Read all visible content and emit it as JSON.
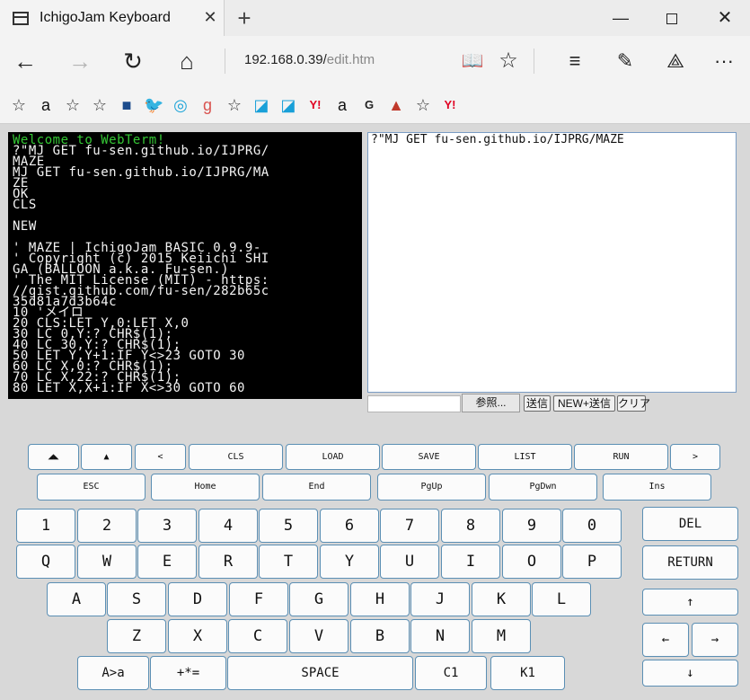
{
  "browser": {
    "tab_title": "IchigoJam Keyboard",
    "tab_close": "✕",
    "new_tab": "+",
    "window_controls": {
      "minimize": "—",
      "close": "✕"
    },
    "address_host": "192.168.0.39/",
    "address_path": "edit.htm",
    "nav": {
      "back": "←",
      "forward": "→",
      "refresh": "↻",
      "home": "⌂",
      "reading_view": "📖",
      "favorite": "☆",
      "hub": "≡",
      "note": "✎",
      "share": "⟁",
      "more": "···"
    },
    "favorites": [
      {
        "icon": "star-icon",
        "glyph": "☆"
      },
      {
        "icon": "amazon-icon",
        "glyph": "a",
        "color": "#111111"
      },
      {
        "icon": "star-icon",
        "glyph": "☆"
      },
      {
        "icon": "star-icon",
        "glyph": "☆"
      },
      {
        "icon": "news-icon",
        "glyph": "■",
        "color": "#1c4c8c"
      },
      {
        "icon": "twitter-icon",
        "glyph": "🐦",
        "color": "#1da1f2"
      },
      {
        "icon": "target-icon",
        "glyph": "◎",
        "color": "#1aa3d8"
      },
      {
        "icon": "g-icon",
        "glyph": "g",
        "color": "#d9534f"
      },
      {
        "icon": "star-icon",
        "glyph": "☆"
      },
      {
        "icon": "app-icon",
        "glyph": "◪",
        "color": "#19a0d8"
      },
      {
        "icon": "app-icon",
        "glyph": "◪",
        "color": "#19a0d8"
      },
      {
        "icon": "yahoo-icon",
        "glyph": "Y!",
        "color": "#e00022"
      },
      {
        "icon": "amazon-icon",
        "glyph": "a",
        "color": "#111111"
      },
      {
        "icon": "g-box-icon",
        "glyph": "G",
        "color": "#222222"
      },
      {
        "icon": "rocket-icon",
        "glyph": "▲",
        "color": "#c0392b"
      },
      {
        "icon": "star-icon",
        "glyph": "☆"
      },
      {
        "icon": "yahoo-icon",
        "glyph": "Y!",
        "color": "#e00022"
      }
    ]
  },
  "terminal": {
    "lines": [
      "Welcome to WebTerm!",
      "?\"MJ GET fu-sen.github.io/IJPRG/",
      "MAZE",
      "MJ GET fu-sen.github.io/IJPRG/MA",
      "ZE",
      "OK",
      "CLS",
      "",
      "NEW",
      "",
      "' MAZE | IchigoJam BASIC 0.9.9-",
      "' Copyright (c) 2015 Keiichi SHI",
      "GA (BALLOON a.k.a. Fu-sen.)",
      "' The MIT License (MIT) - https:",
      "//gist.github.com/fu-sen/282b65c",
      "35d81a7d3b64c",
      "10 'メイロ",
      "20 CLS:LET Y,0:LET X,0",
      "30 LC 0,Y:? CHR$(1);",
      "40 LC 30,Y:? CHR$(1);",
      "50 LET Y,Y+1:IF Y<>23 GOTO 30",
      "60 LC X,0:? CHR$(1);",
      "70 LC X,22:? CHR$(1);",
      "80 LET X,X+1:IF X<>30 GOTO 60"
    ]
  },
  "editor": {
    "value": "?\"MJ GET fu-sen.github.io/IJPRG/MAZE"
  },
  "controls": {
    "browse": "参照...",
    "send": "送信",
    "new_send": "NEW+送信",
    "clear": "クリア"
  },
  "keyboard": {
    "row1": [
      "◢◣",
      "▲",
      "<",
      "CLS",
      "LOAD",
      "SAVE",
      "LIST",
      "RUN",
      ">"
    ],
    "row2": [
      "ESC",
      "Home",
      "End",
      "PgUp",
      "PgDwn",
      "Ins"
    ],
    "row3": [
      "1",
      "2",
      "3",
      "4",
      "5",
      "6",
      "7",
      "8",
      "9",
      "0"
    ],
    "row4": [
      "Q",
      "W",
      "E",
      "R",
      "T",
      "Y",
      "U",
      "I",
      "O",
      "P"
    ],
    "row5": [
      "A",
      "S",
      "D",
      "F",
      "G",
      "H",
      "J",
      "K",
      "L"
    ],
    "row6": [
      "Z",
      "X",
      "C",
      "V",
      "B",
      "N",
      "M"
    ],
    "row7": [
      "A>a",
      "+*=",
      "SPACE",
      "C1",
      "K1"
    ],
    "side": {
      "del": "DEL",
      "return": "RETURN",
      "up": "↑",
      "left": "←",
      "right": "→",
      "down": "↓"
    }
  }
}
